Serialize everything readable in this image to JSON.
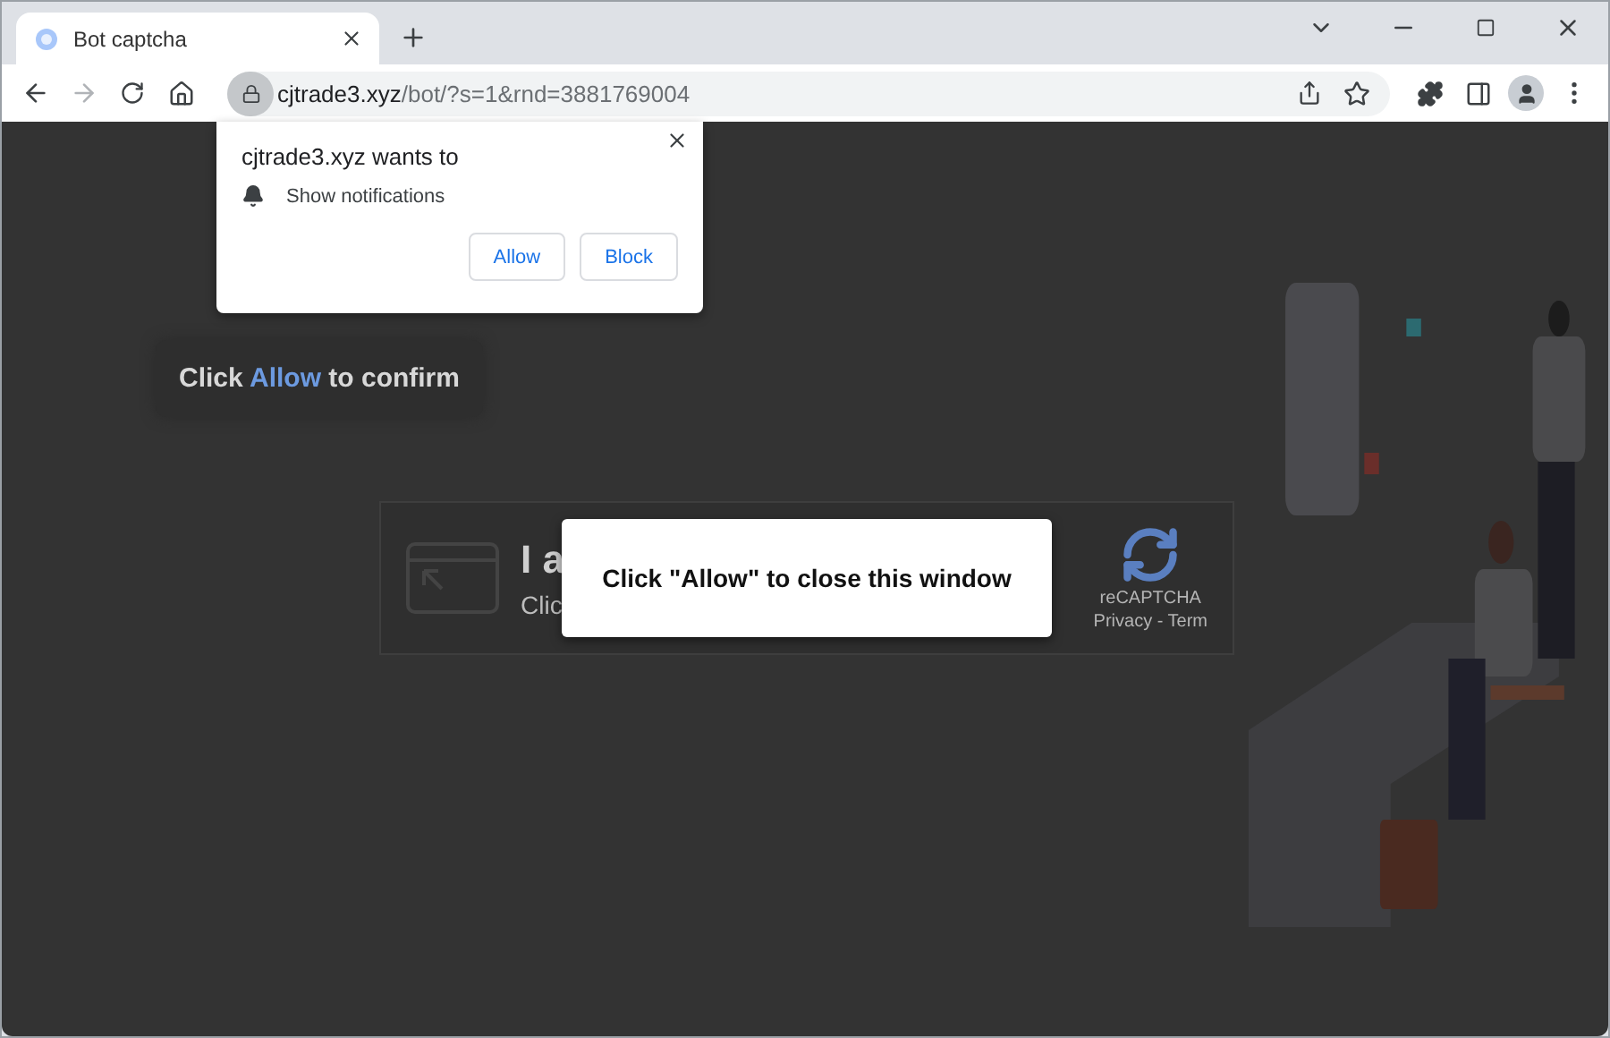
{
  "tab": {
    "title": "Bot captcha",
    "selected": true
  },
  "address_bar": {
    "domain": "cjtrade3.xyz",
    "path": "/bot/?s=1&rnd=3881769004"
  },
  "permission_popup": {
    "title": "cjtrade3.xyz wants to",
    "permission": "Show notifications",
    "buttons": [
      "Allow",
      "Block"
    ]
  },
  "confirm_hint": {
    "before": "Click",
    "highlight": "Allow",
    "after": "to confirm"
  },
  "captcha": {
    "title": "I a",
    "subtitle": "Clic",
    "brand": "reCAPTCHA",
    "links": "Privacy - Term"
  },
  "modal": {
    "message": "Click \"Allow\" to close this window"
  }
}
